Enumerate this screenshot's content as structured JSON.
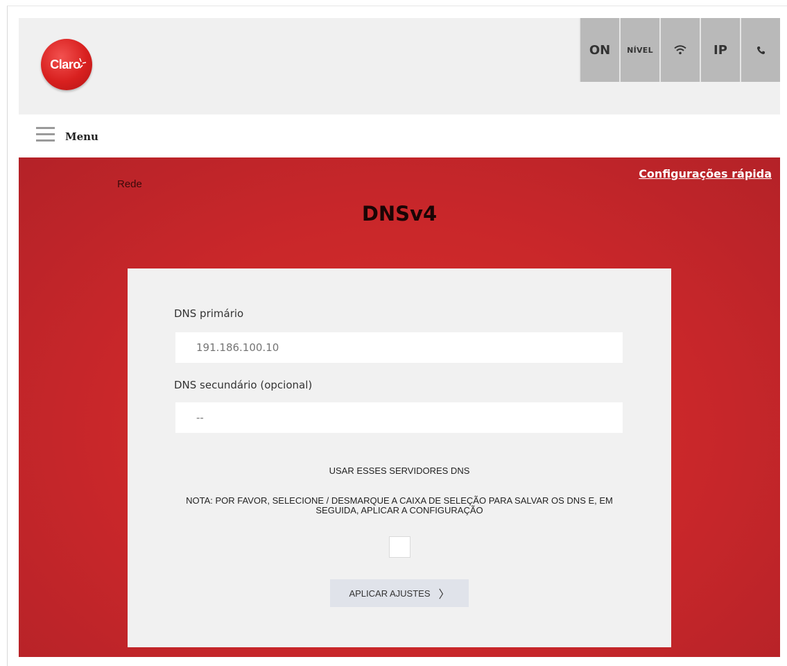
{
  "brand": {
    "logo_text": "Claro",
    "accent": "#d8201f"
  },
  "status_bar": [
    {
      "label": "ON",
      "icon": ""
    },
    {
      "label": "NÍVEL",
      "icon": ""
    },
    {
      "label": "",
      "icon": "wifi-icon"
    },
    {
      "label": "IP",
      "icon": ""
    },
    {
      "label": "",
      "icon": "phone-icon"
    }
  ],
  "menu": {
    "label": "Menu"
  },
  "main": {
    "quick_link": "Configurações rápida",
    "breadcrumb": "Rede",
    "title": "DNSv4"
  },
  "form": {
    "primary": {
      "label": "DNS primário",
      "placeholder": "191.186.100.10"
    },
    "secondary": {
      "label": "DNS secundário (opcional)",
      "placeholder": "--"
    },
    "use_dns_label": "USAR ESSES SERVIDORES DNS",
    "note": "NOTA: POR FAVOR, SELECIONE / DESMARQUE A CAIXA DE SELEÇÃO PARA SALVAR OS DNS E, EM SEGUIDA, APLICAR A CONFIGURAÇÃO",
    "checkbox_checked": false,
    "apply_label": "APLICAR AJUSTES",
    "apply_icon": "chevron-right-icon"
  }
}
